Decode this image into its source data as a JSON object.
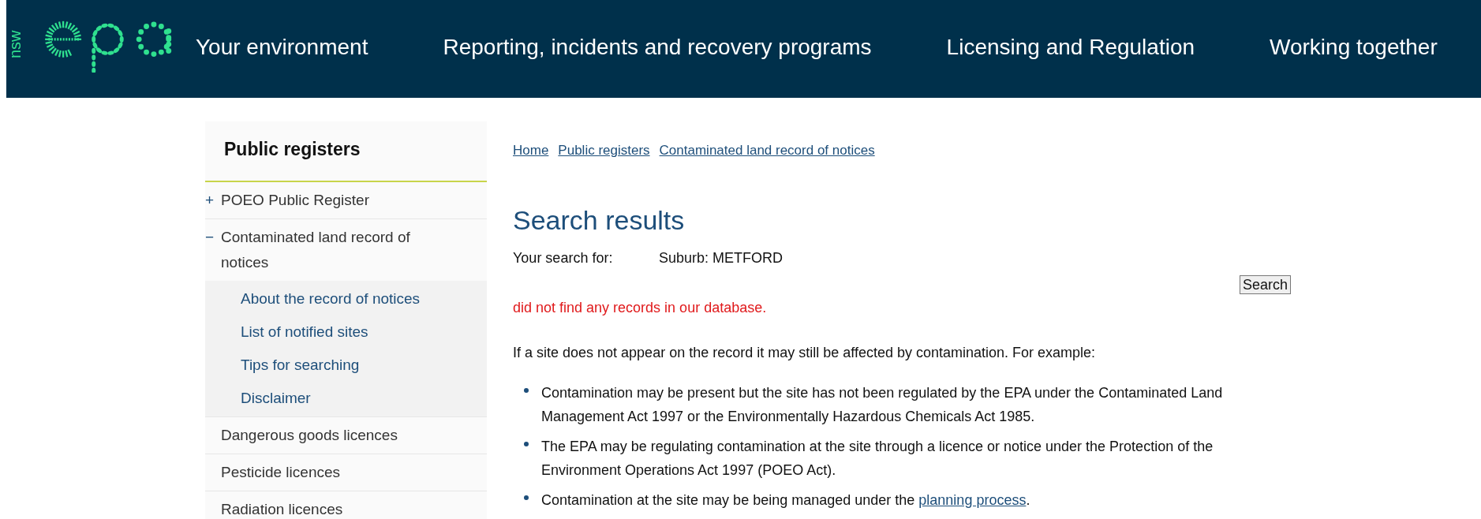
{
  "header": {
    "logo_text": "nsw",
    "nav": [
      {
        "label": "Your environment"
      },
      {
        "label": "Reporting, incidents and recovery programs"
      },
      {
        "label": "Licensing and Regulation"
      },
      {
        "label": "Working together"
      }
    ]
  },
  "sidebar": {
    "title": "Public registers",
    "items": [
      {
        "label": "POEO Public Register",
        "toggle": "+"
      },
      {
        "label": "Contaminated land record of notices",
        "toggle": "−",
        "children": [
          {
            "label": "About the record of notices"
          },
          {
            "label": "List of notified sites"
          },
          {
            "label": "Tips for searching"
          },
          {
            "label": "Disclaimer"
          }
        ]
      },
      {
        "label": "Dangerous goods licences"
      },
      {
        "label": "Pesticide licences"
      },
      {
        "label": "Radiation licences"
      }
    ]
  },
  "breadcrumb": [
    {
      "label": "Home"
    },
    {
      "label": "Public registers"
    },
    {
      "label": "Contaminated land record of notices"
    }
  ],
  "heading": "Search results",
  "search_for": {
    "label": "Your search for:",
    "value": "Suburb: METFORD"
  },
  "search_button": "Search",
  "error_message": "did not find any records in our database.",
  "intro": "If a site does not appear on the record it may still be affected by contamination. For example:",
  "bullets": [
    {
      "text": "Contamination may be present but the site has not been regulated by the EPA under the Contaminated Land Management Act 1997 or the Environmentally Hazardous Chemicals Act 1985."
    },
    {
      "text": "The EPA may be regulating contamination at the site through a licence or notice under the Protection of the Environment Operations Act 1997 (POEO Act)."
    },
    {
      "text": "Contamination at the site may be being managed under the",
      "link": "planning process",
      "after": "."
    }
  ]
}
